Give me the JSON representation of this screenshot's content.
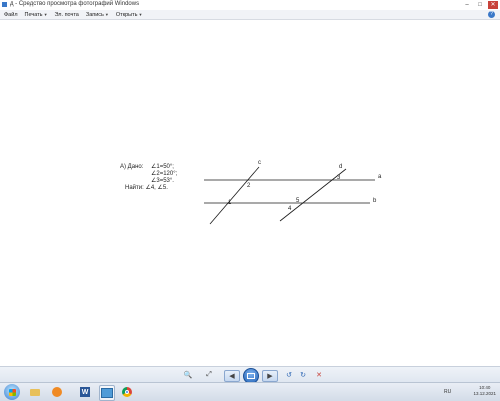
{
  "window": {
    "title": "д - Средство просмотра фотографий Windows",
    "controls": {
      "minimize": "–",
      "maximize": "□",
      "close": "✕"
    }
  },
  "menubar": {
    "items": [
      {
        "label": "Файл"
      },
      {
        "label": "Печать"
      },
      {
        "label": "Эл. почта"
      },
      {
        "label": "Запись"
      },
      {
        "label": "Открыть"
      }
    ],
    "help": "?"
  },
  "image": {
    "given": {
      "prefix": "А) Дано:",
      "angles": [
        "∠1=50°;",
        "∠2=120°;",
        "∠3=53°."
      ],
      "find": "Найти: ∠4, ∠5."
    },
    "labels": {
      "c": "c",
      "d": "d",
      "a": "a",
      "b": "b",
      "n1": "1",
      "n2": "2",
      "n3": "3",
      "n4": "4",
      "n5": "5"
    }
  },
  "toolbar": {
    "zoom": "🔍",
    "fit": "⤢",
    "prev": "◀",
    "next": "▶",
    "rotate_left": "↺",
    "rotate_right": "↻",
    "delete": "✕"
  },
  "taskbar": {
    "language": "RU",
    "time": "10:40",
    "date": "13.12.2021"
  },
  "colors": {
    "line": "#1a1a1a",
    "close_button": "#c8423a",
    "accent": "#3a78c8"
  },
  "icons": [
    "start-icon",
    "folder-icon",
    "media-player-icon",
    "word-icon",
    "photo-viewer-icon",
    "chrome-icon"
  ]
}
